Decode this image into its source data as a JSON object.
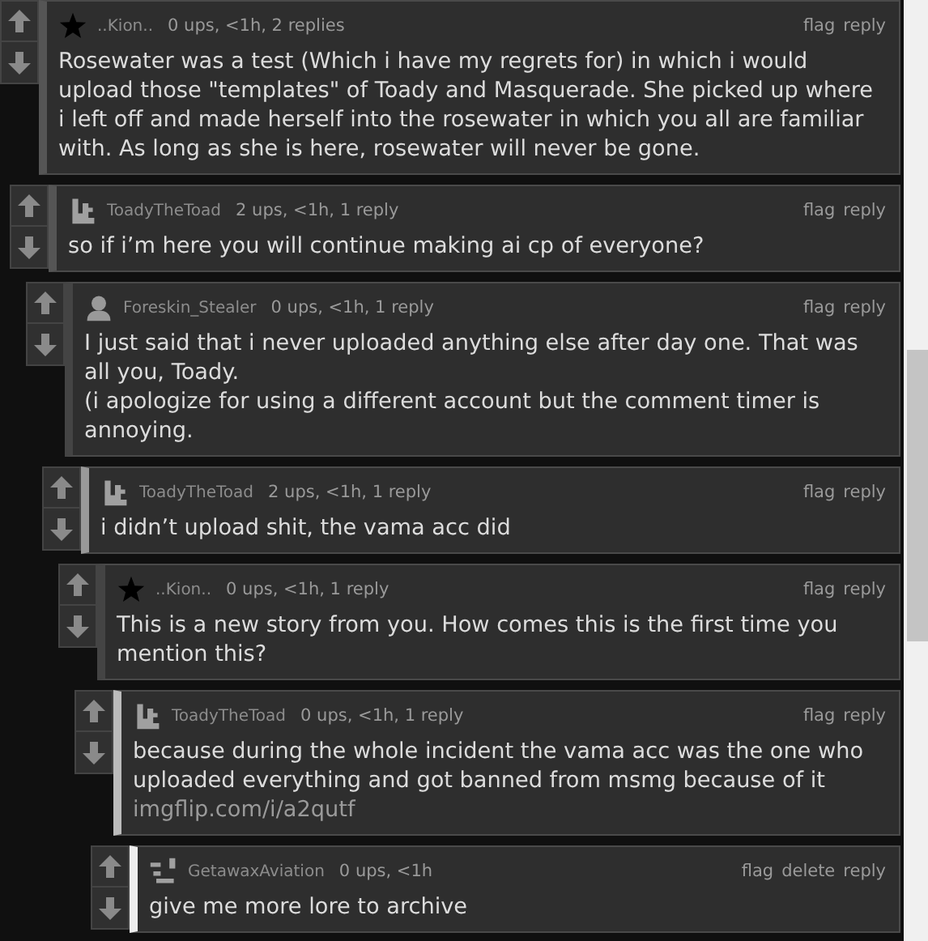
{
  "comments": [
    {
      "user": "..Kion..",
      "avatar": {
        "kind": "star"
      },
      "meta": "0 ups, <1h, 2 replies",
      "actions": [
        "flag",
        "reply"
      ],
      "color": "#555555",
      "body": [
        "Rosewater was a test (Which i have my regrets for) in which i would upload those \"templates\" of Toady and Masquerade. She picked up where i left off and made herself into the rosewater in which you all are familiar with. As long as she is here, rosewater will never be gone."
      ],
      "children": [
        {
          "user": "ToadyTheToad",
          "avatar": {
            "kind": "pixel"
          },
          "meta": "2 ups, <1h, 1 reply",
          "actions": [
            "flag",
            "reply"
          ],
          "color": "#555555",
          "body": [
            "so if i’m here you will continue making ai cp of everyone?"
          ],
          "children": [
            {
              "user": "Foreskin_Stealer",
              "avatar": {
                "kind": "person"
              },
              "meta": "0 ups, <1h, 1 reply",
              "actions": [
                "flag",
                "reply"
              ],
              "color": "#444444",
              "body": [
                "I just said that i never uploaded anything else after day one. That was all you, Toady.",
                "(i apologize for using a different account but the comment timer is annoying."
              ],
              "children": [
                {
                  "user": "ToadyTheToad",
                  "avatar": {
                    "kind": "pixel"
                  },
                  "meta": "2 ups, <1h, 1 reply",
                  "actions": [
                    "flag",
                    "reply"
                  ],
                  "color": "#999999",
                  "body": [
                    "i didn’t upload shit, the vama acc did"
                  ],
                  "children": [
                    {
                      "user": "..Kion..",
                      "avatar": {
                        "kind": "star"
                      },
                      "meta": "0 ups, <1h, 1 reply",
                      "actions": [
                        "flag",
                        "reply"
                      ],
                      "color": "#444444",
                      "body": [
                        "This is a new story from you. How comes this is the first time you mention this?"
                      ],
                      "children": [
                        {
                          "user": "ToadyTheToad",
                          "avatar": {
                            "kind": "pixel"
                          },
                          "meta": "0 ups, <1h, 1 reply",
                          "actions": [
                            "flag",
                            "reply"
                          ],
                          "color": "#bbbbbb",
                          "body": [
                            "because during the whole incident the vama acc was the one who uploaded everything and got banned from msmg because of it"
                          ],
                          "link": "imgflip.com/i/a2qutf",
                          "children": [
                            {
                              "user": "GetawaxAviation",
                              "avatar": {
                                "kind": "blocks"
                              },
                              "meta": "0 ups, <1h",
                              "actions": [
                                "flag",
                                "delete",
                                "reply"
                              ],
                              "color": "#eeeeee",
                              "body": [
                                "give me more lore to archive"
                              ]
                            }
                          ]
                        }
                      ]
                    }
                  ]
                }
              ]
            }
          ]
        }
      ]
    }
  ]
}
